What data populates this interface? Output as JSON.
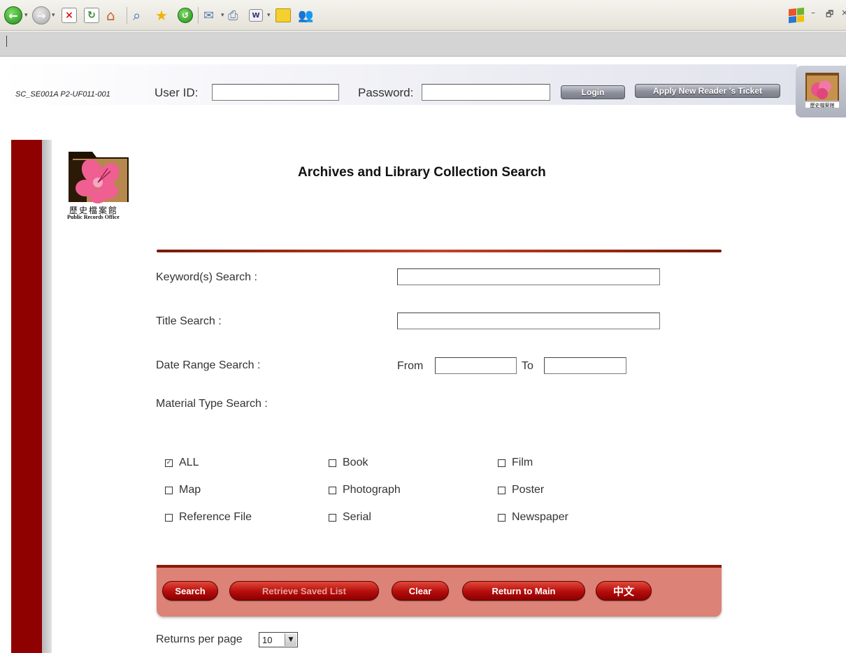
{
  "browser": {
    "toolbar_icons": [
      "back-icon",
      "forward-icon",
      "stop-icon",
      "refresh-icon",
      "home-icon",
      "search-icon",
      "favorites-icon",
      "history-icon",
      "mail-icon",
      "print-icon",
      "edit-icon",
      "notes-icon",
      "messenger-icon"
    ],
    "window_controls": [
      "–",
      "🗗",
      "×"
    ]
  },
  "login": {
    "screen_code": "SC_SE001A P2-UF011-001",
    "user_id_label": "User ID:",
    "user_id_value": "",
    "password_label": "Password:",
    "password_value": "",
    "login_button": "Login",
    "apply_button": "Apply New Reader 's Ticket"
  },
  "logo": {
    "cn": "歷史檔案館",
    "en": "Public Records Office"
  },
  "page": {
    "title": "Archives and Library Collection Search"
  },
  "form": {
    "keyword_label": "Keyword(s) Search :",
    "keyword_value": "",
    "title_label": "Title Search :",
    "title_value": "",
    "date_label": "Date Range Search :",
    "from_label": "From",
    "from_value": "",
    "to_label": "To",
    "to_value": "",
    "material_label": "Material Type Search :",
    "material_types": [
      {
        "label": "ALL",
        "checked": true
      },
      {
        "label": "Book",
        "checked": false
      },
      {
        "label": "Film",
        "checked": false
      },
      {
        "label": "Map",
        "checked": false
      },
      {
        "label": "Photograph",
        "checked": false
      },
      {
        "label": "Poster",
        "checked": false
      },
      {
        "label": "Reference File",
        "checked": false
      },
      {
        "label": "Serial",
        "checked": false
      },
      {
        "label": "Newspaper",
        "checked": false
      }
    ]
  },
  "actions": {
    "search": "Search",
    "retrieve": "Retrieve Saved List",
    "clear": "Clear",
    "return_main": "Return to Main",
    "chinese": "中文"
  },
  "paging": {
    "label": "Returns per page",
    "value": "10"
  }
}
